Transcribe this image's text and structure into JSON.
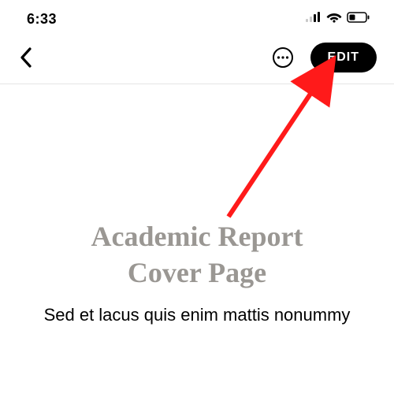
{
  "status": {
    "time": "6:33"
  },
  "nav": {
    "edit_label": "EDIT"
  },
  "document": {
    "title_line1": "Academic Report",
    "title_line2": "Cover Page",
    "subtitle": "Sed et lacus quis enim mattis nonummy"
  }
}
